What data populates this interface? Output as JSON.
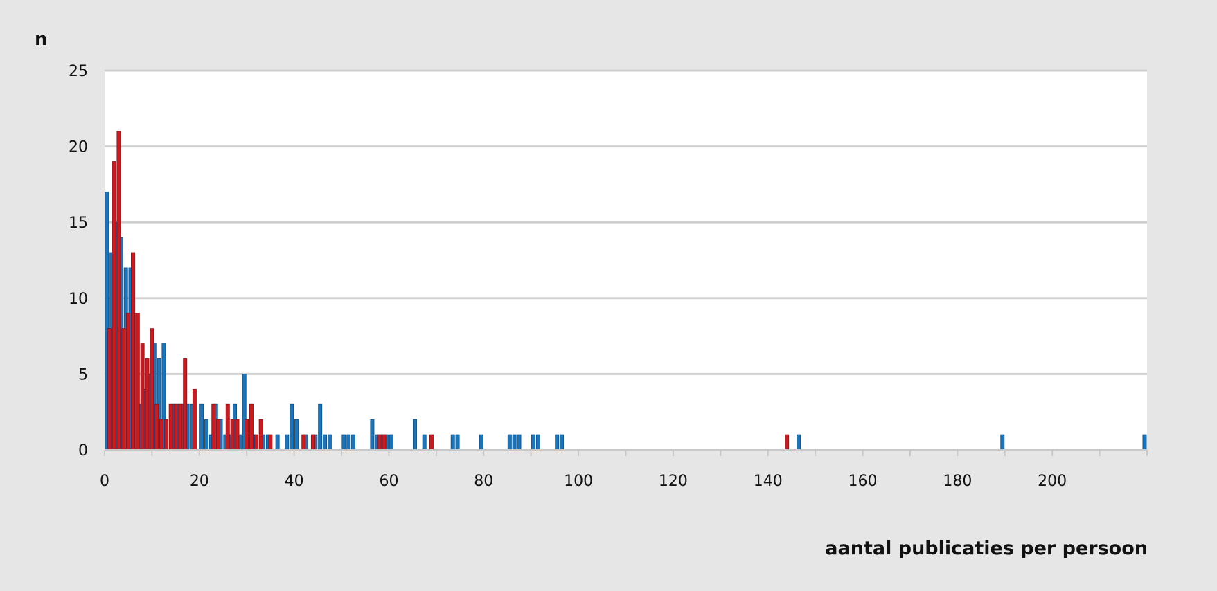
{
  "chart_data": {
    "type": "bar",
    "title": "",
    "ylabel": "n",
    "xlabel": "aantal publicaties per persoon",
    "xlim": [
      0,
      220
    ],
    "ylim": [
      0,
      25
    ],
    "x_ticks": [
      0,
      20,
      40,
      60,
      80,
      100,
      120,
      140,
      160,
      180,
      200
    ],
    "y_ticks": [
      0,
      5,
      10,
      15,
      20,
      25
    ],
    "grid": "horizontal",
    "legend": "none",
    "series": [
      {
        "color": "#1a75bc",
        "points": [
          [
            0,
            17
          ],
          [
            1,
            13
          ],
          [
            2,
            15
          ],
          [
            3,
            14
          ],
          [
            4,
            12
          ],
          [
            5,
            12
          ],
          [
            6,
            9
          ],
          [
            7,
            3
          ],
          [
            8,
            4
          ],
          [
            9,
            5
          ],
          [
            10,
            7
          ],
          [
            11,
            6
          ],
          [
            12,
            7
          ],
          [
            14,
            3
          ],
          [
            15,
            3
          ],
          [
            16,
            3
          ],
          [
            17,
            3
          ],
          [
            18,
            3
          ],
          [
            20,
            3
          ],
          [
            21,
            2
          ],
          [
            22,
            1
          ],
          [
            23,
            3
          ],
          [
            24,
            2
          ],
          [
            25,
            1
          ],
          [
            26,
            1
          ],
          [
            27,
            3
          ],
          [
            28,
            1
          ],
          [
            29,
            5
          ],
          [
            30,
            1
          ],
          [
            31,
            1
          ],
          [
            33,
            1
          ],
          [
            34,
            1
          ],
          [
            36,
            1
          ],
          [
            38,
            1
          ],
          [
            39,
            3
          ],
          [
            40,
            2
          ],
          [
            42,
            1
          ],
          [
            44,
            1
          ],
          [
            45,
            3
          ],
          [
            46,
            1
          ],
          [
            47,
            1
          ],
          [
            50,
            1
          ],
          [
            51,
            1
          ],
          [
            52,
            1
          ],
          [
            56,
            2
          ],
          [
            57,
            1
          ],
          [
            58,
            1
          ],
          [
            59,
            1
          ],
          [
            60,
            1
          ],
          [
            65,
            2
          ],
          [
            67,
            1
          ],
          [
            73,
            1
          ],
          [
            74,
            1
          ],
          [
            79,
            1
          ],
          [
            85,
            1
          ],
          [
            86,
            1
          ],
          [
            87,
            1
          ],
          [
            90,
            1
          ],
          [
            91,
            1
          ],
          [
            95,
            1
          ],
          [
            96,
            1
          ],
          [
            146,
            1
          ],
          [
            189,
            1
          ],
          [
            219,
            1
          ]
        ]
      },
      {
        "color": "#cc1a1f",
        "points": [
          [
            0.5,
            8
          ],
          [
            1.5,
            19
          ],
          [
            2.5,
            21
          ],
          [
            3.5,
            8
          ],
          [
            4.5,
            9
          ],
          [
            5.5,
            13
          ],
          [
            6.5,
            9
          ],
          [
            7.5,
            7
          ],
          [
            8.5,
            6
          ],
          [
            9.5,
            8
          ],
          [
            10.5,
            3
          ],
          [
            11.5,
            2
          ],
          [
            12.5,
            2
          ],
          [
            13.5,
            3
          ],
          [
            14.5,
            3
          ],
          [
            15.5,
            3
          ],
          [
            16.5,
            6
          ],
          [
            18.5,
            4
          ],
          [
            22.5,
            3
          ],
          [
            23.5,
            2
          ],
          [
            25.5,
            3
          ],
          [
            26.5,
            2
          ],
          [
            27.5,
            2
          ],
          [
            29.5,
            2
          ],
          [
            30.5,
            3
          ],
          [
            31.5,
            1
          ],
          [
            32.5,
            2
          ],
          [
            34.5,
            1
          ],
          [
            41.5,
            1
          ],
          [
            43.5,
            1
          ],
          [
            57.5,
            1
          ],
          [
            58.5,
            1
          ],
          [
            68.5,
            1
          ],
          [
            143.5,
            1
          ]
        ]
      }
    ]
  }
}
